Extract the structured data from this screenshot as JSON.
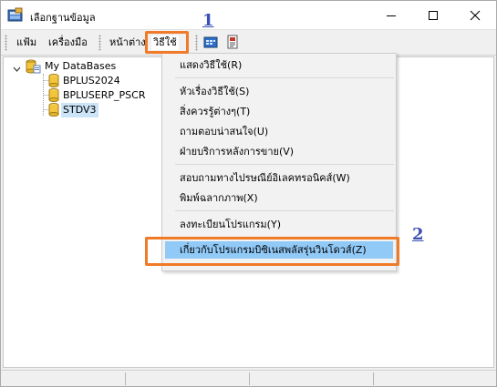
{
  "window": {
    "title": "เลือกฐานข้อมูล",
    "minimize_glyph": "—",
    "maximize_glyph": "☐",
    "close_glyph": "✕"
  },
  "menubar": {
    "items": [
      {
        "label": "แฟ้ม"
      },
      {
        "label": "เครื่องมือ"
      },
      {
        "label": "หน้าต่าง"
      },
      {
        "label": "วิธีใช้"
      }
    ],
    "tool_icons": [
      "calendar-window-icon",
      "document-print-icon"
    ]
  },
  "annotations": {
    "step1": "1",
    "step2": "2",
    "highlight_color": "#f07a28",
    "number_color": "#3a4fb6"
  },
  "tree": {
    "root_label": "My DataBases",
    "children": [
      {
        "label": "BPLUS2024"
      },
      {
        "label": "BPLUSERP_PSCR"
      },
      {
        "label": "STDV3"
      }
    ]
  },
  "help_menu": {
    "items": [
      {
        "label": "แสดงวิธีใช้(R)"
      },
      {
        "label": "หัวเรื่องวิธีใช้(S)"
      },
      {
        "label": "สิ่งควรรู้ต่างๆ(T)"
      },
      {
        "label": "ถามตอบน่าสนใจ(U)"
      },
      {
        "label": "ฝ่ายบริการหลังการขาย(V)"
      },
      {
        "label": "สอบถามทางไปรษณีย์อิเลคทรอนิคส์(W)"
      },
      {
        "label": "พิมพ์ฉลากภาพ(X)"
      },
      {
        "label": "ลงทะเบียนโปรแกรม(Y)"
      },
      {
        "label": "เกี่ยวกับโปรแกรมบิซิเนสพลัสรุ่นวินโดวส์(Z)"
      }
    ],
    "highlight_color": "#91c9f7"
  }
}
